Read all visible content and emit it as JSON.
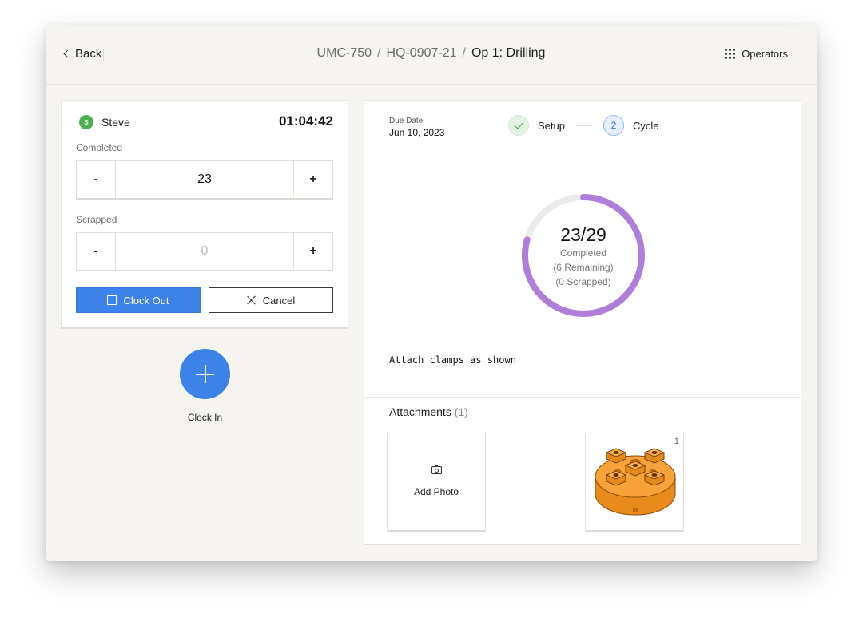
{
  "header": {
    "back_label": "Back",
    "breadcrumb": [
      "UMC-750",
      "HQ-0907-21",
      "Op 1: Drilling"
    ],
    "breadcrumb_separator": "/",
    "operators_label": "Operators"
  },
  "session": {
    "user_name": "Steve",
    "user_initial": "S",
    "timer": "01:04:42",
    "completed_label": "Completed",
    "completed_value": "23",
    "scrapped_label": "Scrapped",
    "scrapped_value": "0",
    "minus_label": "-",
    "plus_label": "+",
    "clock_out_label": "Clock Out",
    "cancel_label": "Cancel"
  },
  "clock_in": {
    "label": "Clock In"
  },
  "operation": {
    "due_label": "Due Date",
    "due_value": "Jun 10, 2023",
    "steps": [
      {
        "name": "Setup",
        "status": "done"
      },
      {
        "name": "Cycle",
        "status": "active",
        "number": "2"
      }
    ],
    "progress": {
      "completed": 23,
      "total": 29,
      "text": "23/29",
      "completed_label": "Completed",
      "remaining_label": "(6 Remaining)",
      "scrapped_label": "(0 Scrapped)"
    },
    "instruction": "Attach clamps as shown"
  },
  "attachments": {
    "title": "Attachments",
    "count": "(1)",
    "add_photo_label": "Add Photo",
    "items": [
      {
        "index": "1",
        "icon": "machined-part-image"
      }
    ]
  },
  "colors": {
    "accent": "#3d82e6",
    "progress": "#b07ed8",
    "progress_track": "#ebebeb",
    "success": "#43a84a",
    "avatar": "#4caf50"
  }
}
